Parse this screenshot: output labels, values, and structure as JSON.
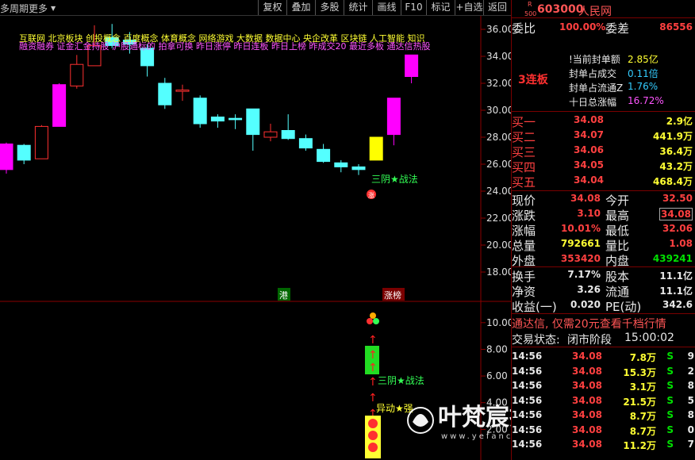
{
  "toolbar": {
    "period_label": "多周期",
    "more_label": "更多",
    "more_icon": "chevron-down-icon",
    "buttons": [
      "复权",
      "叠加",
      "多股",
      "统计",
      "画线",
      "F10",
      "标记",
      "+自选",
      "返回"
    ]
  },
  "chart": {
    "concept_tags_line1": "互联网   北京板块  创投概念 百度概念 体育概念 网络游戏 大数据 数据中心 央企改革 区块链 人工智能 知识",
    "concept_tags_line2": "融资融券 证金汇金持股 沪股通标的 拍拿可换 昨日涨停 昨日连板 昨日上榜 昨成交20 最近多板 通达信热股",
    "sanyin_label_main": "三阴★战法",
    "sanyin_label_sub": "三阴★战法",
    "yidong_label": "异动★强",
    "gang_tag": "港",
    "zhangbang_tag": "涨榜",
    "price_axis": [
      "36.00",
      "34.00",
      "32.00",
      "30.00",
      "28.00",
      "26.00",
      "24.00",
      "22.00",
      "20.00",
      "18.00"
    ],
    "ind_axis": [
      "10.00",
      "8.00",
      "6.00",
      "4.00",
      "2.00"
    ]
  },
  "chart_data": {
    "type": "candlestick",
    "ylim": [
      17.0,
      37.0
    ],
    "candles": [
      {
        "o": 25.6,
        "c": 27.5,
        "h": 27.6,
        "l": 25.3
      },
      {
        "o": 26.3,
        "c": 27.4,
        "h": 27.5,
        "l": 26.0
      },
      {
        "o": 28.8,
        "c": 26.4,
        "h": 28.9,
        "l": 26.4
      },
      {
        "o": 28.8,
        "c": 31.9,
        "h": 32.0,
        "l": 28.8
      },
      {
        "o": 33.4,
        "c": 31.8,
        "h": 34.1,
        "l": 31.6
      },
      {
        "o": 34.8,
        "c": 33.3,
        "h": 36.3,
        "l": 33.3
      },
      {
        "o": 34.8,
        "c": 35.4,
        "h": 36.4,
        "l": 34.6
      },
      {
        "o": 35.2,
        "c": 34.9,
        "h": 35.8,
        "l": 34.2
      },
      {
        "o": 34.6,
        "c": 33.3,
        "h": 34.9,
        "l": 32.5
      },
      {
        "o": 32.0,
        "c": 30.4,
        "h": 32.4,
        "l": 30.1
      },
      {
        "o": 31.4,
        "c": 31.5,
        "h": 31.9,
        "l": 30.7
      },
      {
        "o": 30.9,
        "c": 29.0,
        "h": 31.1,
        "l": 28.7
      },
      {
        "o": 29.5,
        "c": 29.2,
        "h": 29.7,
        "l": 28.7
      },
      {
        "o": 29.4,
        "c": 29.3,
        "h": 29.7,
        "l": 28.6
      },
      {
        "o": 30.1,
        "c": 28.2,
        "h": 30.1,
        "l": 27.0
      },
      {
        "o": 28.0,
        "c": 28.4,
        "h": 29.0,
        "l": 27.7
      },
      {
        "o": 28.5,
        "c": 27.9,
        "h": 29.7,
        "l": 27.8
      },
      {
        "o": 27.9,
        "c": 27.2,
        "h": 28.2,
        "l": 27.0
      },
      {
        "o": 27.1,
        "c": 26.2,
        "h": 27.5,
        "l": 26.1
      },
      {
        "o": 26.1,
        "c": 25.8,
        "h": 26.3,
        "l": 25.4
      },
      {
        "o": 25.8,
        "c": 25.6,
        "h": 26.0,
        "l": 25.2
      },
      {
        "o": 26.3,
        "c": 28.0,
        "h": 28.0,
        "l": 26.3
      },
      {
        "o": 28.2,
        "c": 30.9,
        "h": 30.9,
        "l": 27.4
      },
      {
        "o": 32.5,
        "c": 34.1,
        "h": 34.1,
        "l": 32.0
      }
    ]
  },
  "stock": {
    "r_label": "R",
    "level": "500",
    "code": "603000",
    "name": "人民网",
    "weibi_label": "委比",
    "weibi_value": "100.00%",
    "weicha_label": "委差",
    "weicha_value": "86556",
    "board_count": "3连板",
    "seal_lines": [
      {
        "label": "!当前封单额",
        "value": "2.85亿"
      },
      {
        "label": "封单占成交",
        "value": "0.11倍"
      },
      {
        "label": "封单占流通Z",
        "value": "1.76%"
      },
      {
        "label": "十日总涨幅",
        "value": "16.72%"
      }
    ],
    "bids": [
      {
        "label": "买一",
        "price": "34.08",
        "vol": "2.9亿"
      },
      {
        "label": "买二",
        "price": "34.07",
        "vol": "441.9万"
      },
      {
        "label": "买三",
        "price": "34.06",
        "vol": "36.4万"
      },
      {
        "label": "买四",
        "price": "34.05",
        "vol": "43.2万"
      },
      {
        "label": "买五",
        "price": "34.04",
        "vol": "468.4万"
      }
    ],
    "quotes": [
      {
        "l1": "现价",
        "v1": "34.08",
        "l2": "今开",
        "v2": "32.50"
      },
      {
        "l1": "涨跌",
        "v1": "3.10",
        "l2": "最高",
        "v2": "34.08"
      },
      {
        "l1": "涨幅",
        "v1": "10.01%",
        "l2": "最低",
        "v2": "32.06"
      },
      {
        "l1": "总量",
        "v1": "792661",
        "l2": "量比",
        "v2": "1.08"
      },
      {
        "l1": "外盘",
        "v1": "353420",
        "l2": "内盘",
        "v2": "439241"
      }
    ],
    "quotes2": [
      {
        "l1": "换手",
        "v1": "7.17%",
        "l2": "股本",
        "v2": "11.1亿"
      },
      {
        "l1": "净资",
        "v1": "3.26",
        "l2": "流通",
        "v2": "11.1亿"
      },
      {
        "l1": "收益(一)",
        "v1": "0.020",
        "l2": "PE(动)",
        "v2": "342.6"
      }
    ],
    "ad_text": "通达信, 仅需20元查看千档行情",
    "trade_status_label": "交易状态:",
    "trade_status_value": "闭市阶段",
    "trade_time": "15:00:02",
    "ticks": [
      {
        "t": "14:56",
        "p": "34.08",
        "v": "7.8万",
        "s": "S",
        "n": "9"
      },
      {
        "t": "14:56",
        "p": "34.08",
        "v": "15.3万",
        "s": "S",
        "n": "2"
      },
      {
        "t": "14:56",
        "p": "34.08",
        "v": "3.1万",
        "s": "S",
        "n": "8"
      },
      {
        "t": "14:56",
        "p": "34.08",
        "v": "21.5万",
        "s": "S",
        "n": "5"
      },
      {
        "t": "14:56",
        "p": "34.08",
        "v": "8.7万",
        "s": "S",
        "n": "8"
      },
      {
        "t": "14:56",
        "p": "34.08",
        "v": "8.7万",
        "s": "S",
        "n": "0"
      },
      {
        "t": "14:56",
        "p": "34.08",
        "v": "11.2万",
        "s": "S",
        "n": "7"
      }
    ]
  },
  "watermark": {
    "title": "叶梵宸指标公式网",
    "url": "www.yefanchen.com",
    "sub": "指标公式网"
  }
}
